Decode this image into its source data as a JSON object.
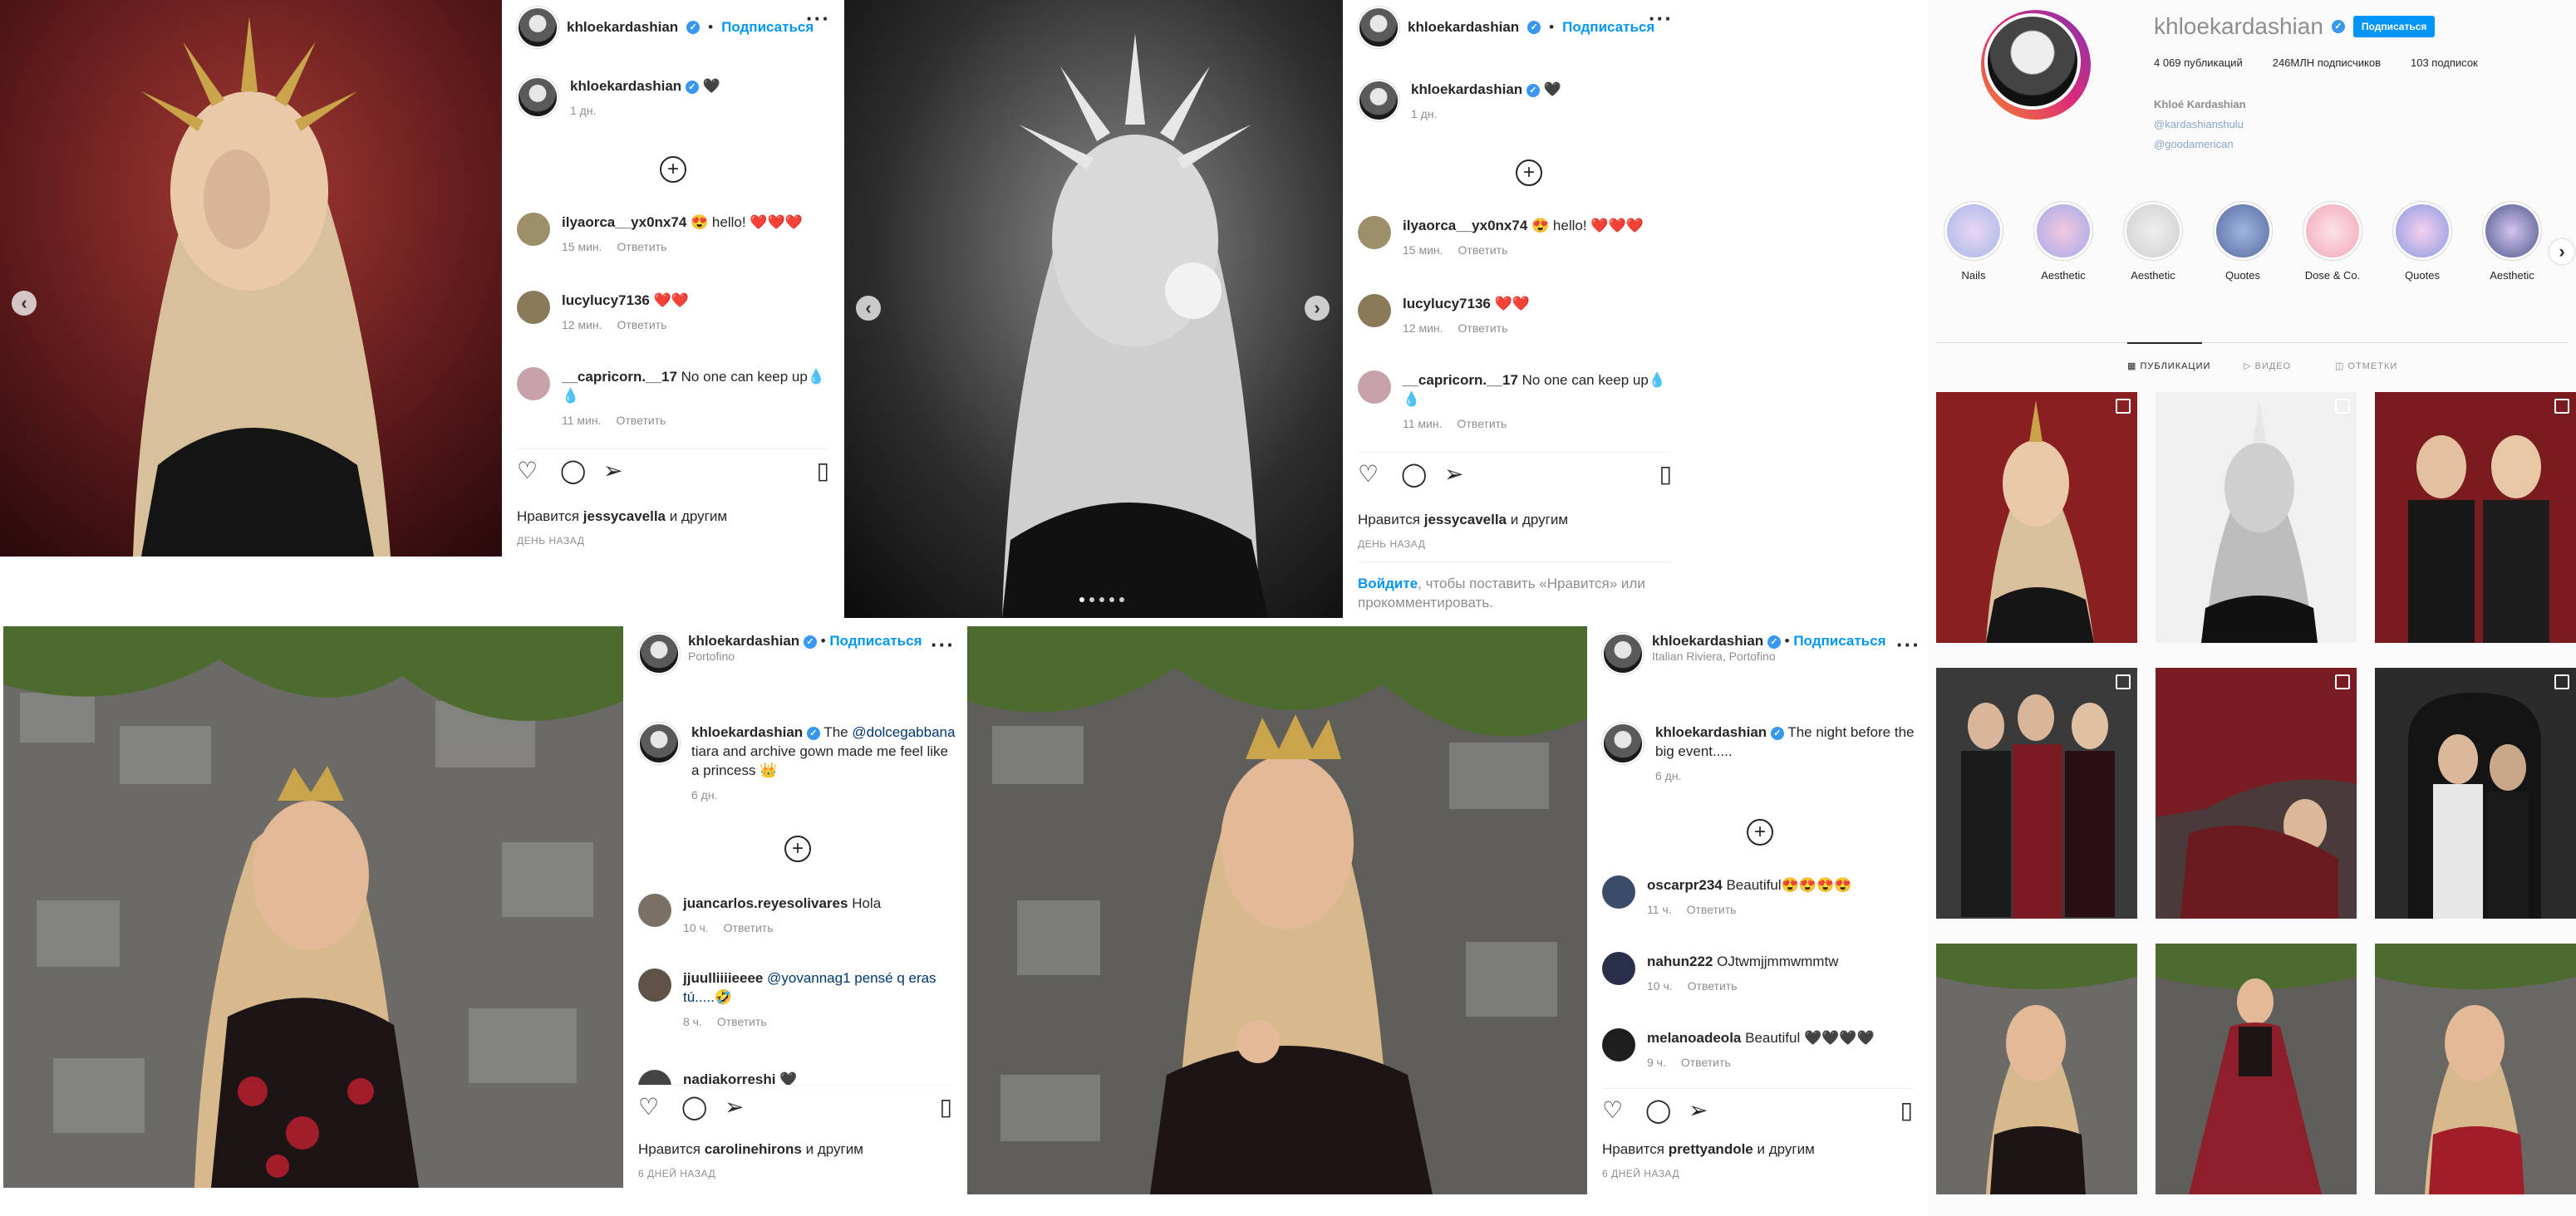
{
  "colors": {
    "link": "#0095f6",
    "verified": "#3897f0",
    "text": "#262626",
    "muted": "#8e8e8e"
  },
  "post1": {
    "username": "khloekardashian",
    "follow": "Подписаться",
    "caption_user": "khloekardashian",
    "caption_text": "🖤",
    "caption_time": "1 дн.",
    "comments": [
      {
        "user": "ilyaorca__yx0nx74",
        "text": "😍 hello! ❤️❤️❤️",
        "time": "15 мин.",
        "reply": "Ответить"
      },
      {
        "user": "lucylucy7136",
        "text": "❤️❤️",
        "time": "12 мин.",
        "reply": "Ответить"
      },
      {
        "user": "__capricorn.__17",
        "text": "No one can keep up💧💧",
        "time": "11 мин.",
        "reply": "Ответить"
      }
    ],
    "likes_prefix": "Нравится",
    "likes_user": "jessycavella",
    "likes_suffix": "и другим",
    "ago": "ДЕНЬ НАЗАД"
  },
  "post2": {
    "username": "khloekardashian",
    "follow": "Подписаться",
    "caption_user": "khloekardashian",
    "caption_text": "🖤",
    "caption_time": "1 дн.",
    "comments": [
      {
        "user": "ilyaorca__yx0nx74",
        "text": "😍 hello! ❤️❤️❤️",
        "time": "15 мин.",
        "reply": "Ответить"
      },
      {
        "user": "lucylucy7136",
        "text": "❤️❤️",
        "time": "12 мин.",
        "reply": "Ответить"
      },
      {
        "user": "__capricorn.__17",
        "text": "No one can keep up💧💧",
        "time": "11 мин.",
        "reply": "Ответить"
      }
    ],
    "likes_prefix": "Нравится",
    "likes_user": "jessycavella",
    "likes_suffix": "и другим",
    "ago": "ДЕНЬ НАЗАД",
    "login_link": "Войдите",
    "login_text": ", чтобы поставить «Нравится» или прокомментировать."
  },
  "post3": {
    "username": "khloekardashian",
    "follow": "Подписаться",
    "location": "Portofino",
    "caption_user": "khloekardashian",
    "caption_mention": "@dolcegabbana",
    "caption_pre": "The",
    "caption_text": "tiara and archive gown made me feel like a princess 👑",
    "caption_time": "6 дн.",
    "comments": [
      {
        "user": "juancarlos.reyesolivares",
        "text": "Hola",
        "time": "10 ч.",
        "reply": "Ответить"
      },
      {
        "user": "jjuulliiiieeee",
        "text": "@yovannag1 pensé q eras tú.....🤣",
        "time": "8 ч.",
        "reply": "Ответить"
      },
      {
        "user": "nadiakorreshi",
        "text": "🖤",
        "time": "",
        "reply": ""
      }
    ],
    "likes_prefix": "Нравится",
    "likes_user": "carolinehirons",
    "likes_suffix": "и другим",
    "ago": "6 ДНЕЙ НАЗАД"
  },
  "post4": {
    "username": "khloekardashian",
    "follow": "Подписаться",
    "location": "Italian Riviera, Portofino",
    "caption_user": "khloekardashian",
    "caption_text": "The night before the big event.....",
    "caption_time": "6 дн.",
    "comments": [
      {
        "user": "oscarpr234",
        "text": "Beautiful😍😍😍😍",
        "time": "11 ч.",
        "reply": "Ответить"
      },
      {
        "user": "nahun222",
        "text": "OJtwmjjmmwmmtw",
        "time": "10 ч.",
        "reply": "Ответить"
      },
      {
        "user": "melanoadeola",
        "text": "Beautiful 🖤🖤🖤🖤",
        "time": "9 ч.",
        "reply": "Ответить"
      }
    ],
    "likes_prefix": "Нравится",
    "likes_user": "prettyandole",
    "likes_suffix": "и другим",
    "ago": "6 ДНЕЙ НАЗАД"
  },
  "profile": {
    "username": "khloekardashian",
    "follow": "Подписаться",
    "posts": "4 069 публикаций",
    "followers": "246МЛН подписчиков",
    "following": "103 подписок",
    "full_name": "Khloé Kardashian",
    "link1": "@kardashianshulu",
    "link2": "@goodamerican",
    "highlights": [
      "Nails",
      "Aesthetic",
      "Aesthetic",
      "Quotes",
      "Dose & Co.",
      "Quotes",
      "Aesthetic"
    ],
    "tabs": [
      "ПУБЛИКАЦИИ",
      "ВИДЕО",
      "ОТМЕТКИ"
    ]
  }
}
